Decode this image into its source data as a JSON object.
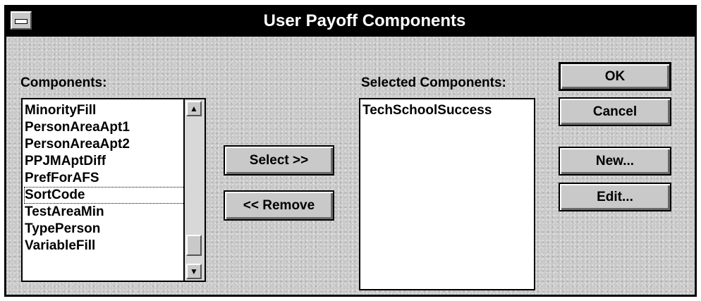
{
  "window": {
    "title": "User Payoff Components"
  },
  "components": {
    "label": "Components:",
    "items": [
      "MinorityFill",
      "PersonAreaApt1",
      "PersonAreaApt2",
      "PPJMAptDiff",
      "PrefForAFS",
      "SortCode",
      "TestAreaMin",
      "TypePerson",
      "VariableFill"
    ],
    "focused_index": 5
  },
  "selected": {
    "label": "Selected Components:",
    "items": [
      "TechSchoolSuccess"
    ]
  },
  "buttons": {
    "select": "Select >>",
    "remove": "<< Remove",
    "ok": "OK",
    "cancel": "Cancel",
    "new": "New...",
    "edit": "Edit..."
  },
  "icons": {
    "scroll_up": "scroll-up-arrow-icon",
    "scroll_down": "scroll-down-arrow-icon",
    "system_menu": "system-menu-icon"
  }
}
